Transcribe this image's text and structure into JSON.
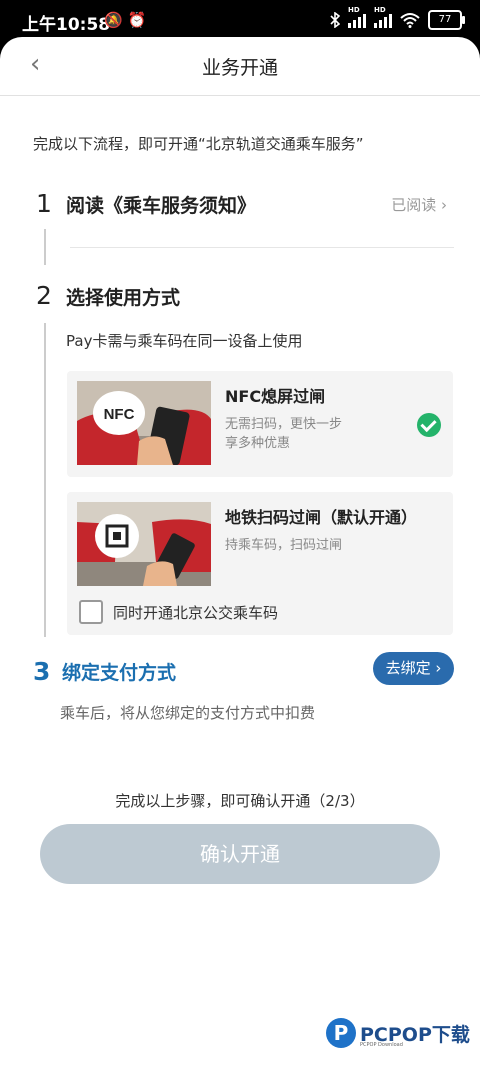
{
  "status_bar": {
    "time": "上午10:58",
    "icons": "🔕 ⏰",
    "battery": "77",
    "hd": "HD"
  },
  "header": {
    "back_glyph": "‹",
    "title": "业务开通"
  },
  "intro": "完成以下流程，即可开通“北京轨道交通乘车服务”",
  "steps": [
    {
      "number": "1",
      "title": "阅读《乘车服务须知》",
      "status": "已阅读 ›"
    },
    {
      "number": "2",
      "title": "选择使用方式",
      "description": "Pay卡需与乘车码在同一设备上使用"
    },
    {
      "number": "3",
      "title": "绑定支付方式",
      "button": "去绑定 ›",
      "description": "乘车后，将从您绑定的支付方式中扣费"
    }
  ],
  "options": [
    {
      "title": "NFC熄屏过闸",
      "sub_line1": "无需扫码，更快一步",
      "sub_line2": "享多种优惠",
      "illus_text": "NFC",
      "selected": true
    },
    {
      "title": "地铁扫码过闸（默认开通）",
      "sub_line1": "持乘车码，扫码过闸",
      "checkbox_label": "同时开通北京公交乘车码",
      "checked": false
    }
  ],
  "progress_text": "完成以上步骤，即可确认开通（2/3）",
  "confirm_button": "确认开通",
  "watermark": {
    "logo_letter": "P",
    "text": "PCPOP下载",
    "small": "PCPOP Download"
  },
  "colors": {
    "accent_blue": "#2a6bad",
    "check_green": "#24b36a",
    "disabled_button": "#bdc9d2"
  }
}
